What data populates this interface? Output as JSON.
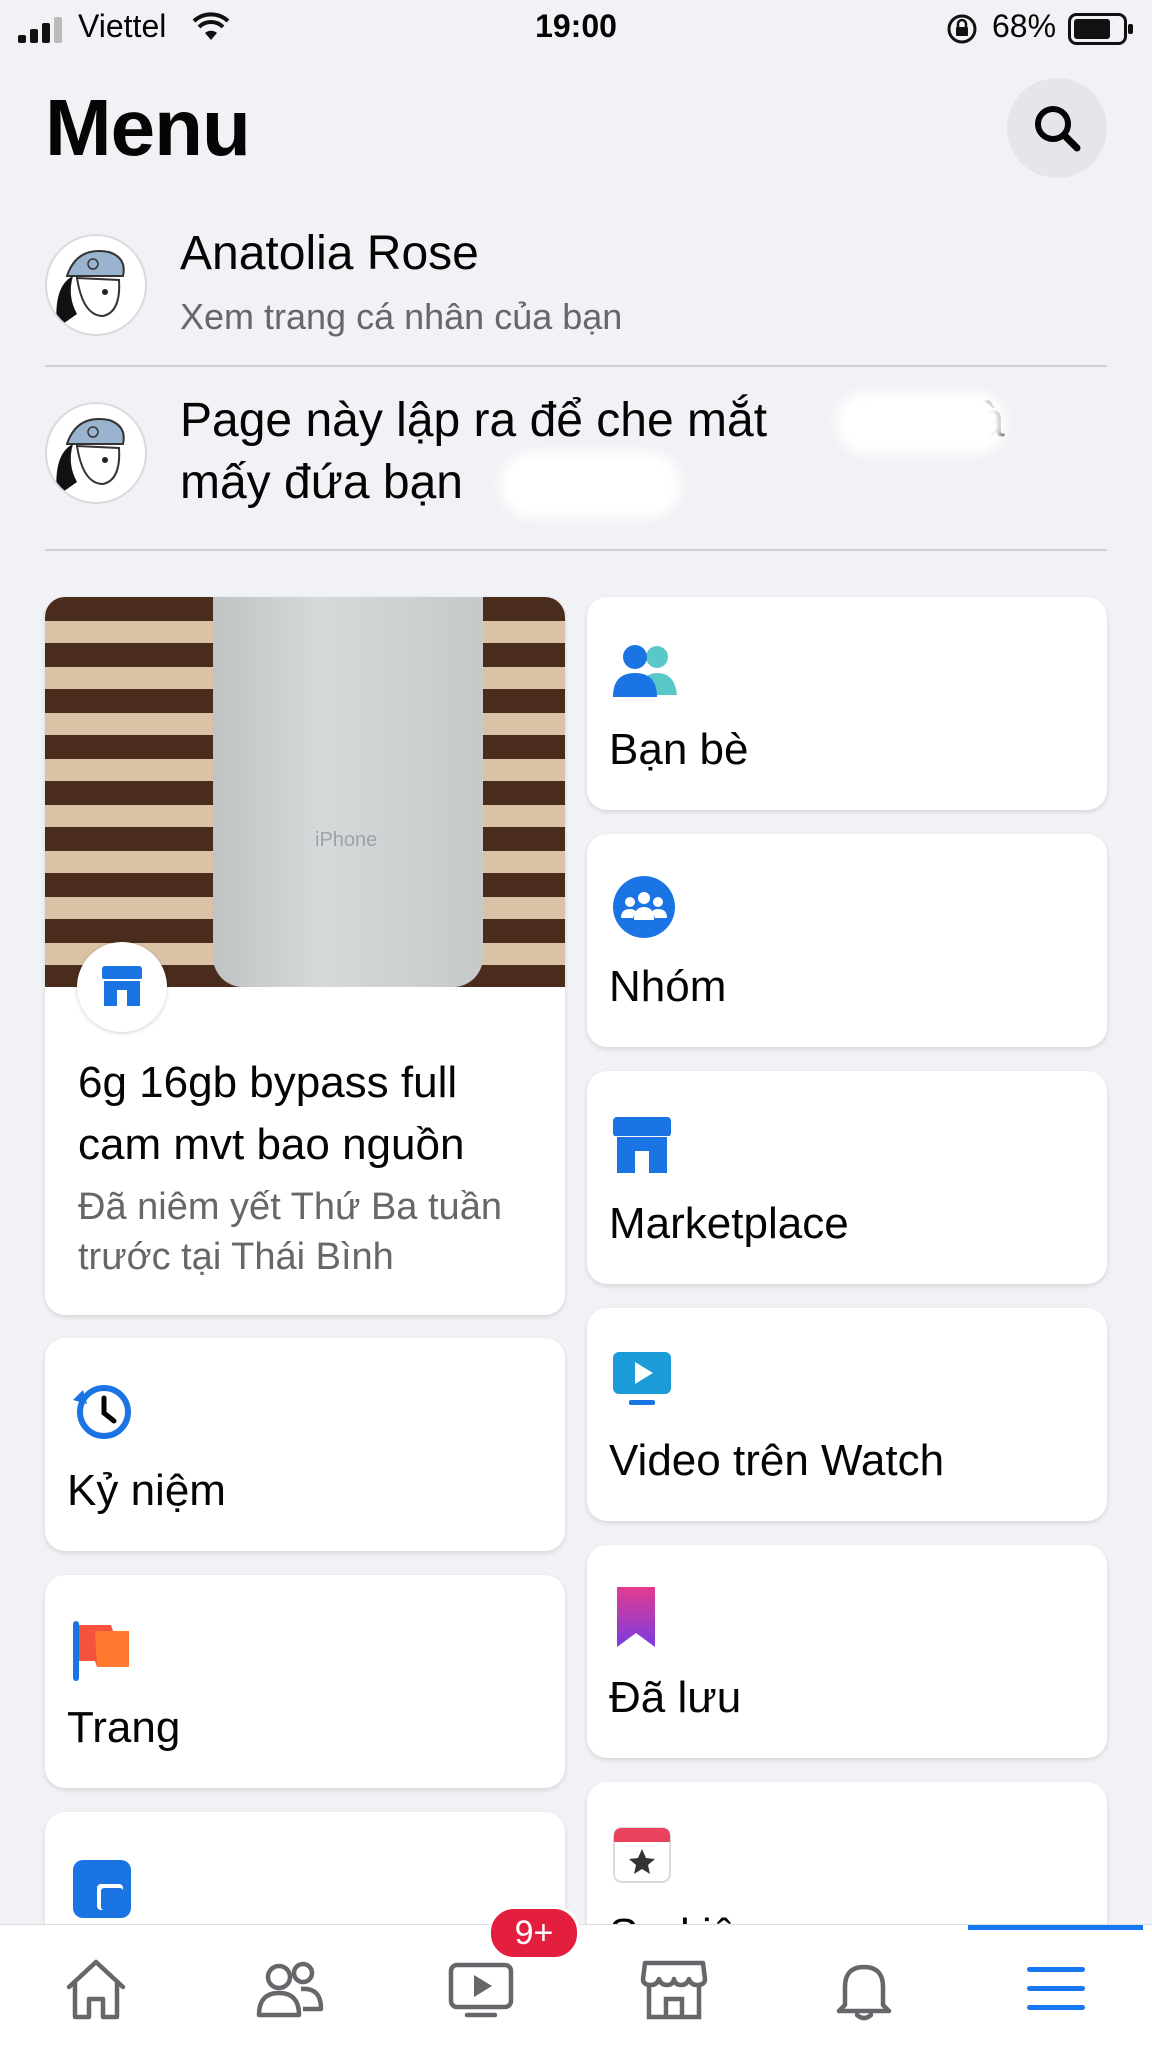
{
  "status_bar": {
    "carrier": "Viettel",
    "time": "19:00",
    "battery": "68%"
  },
  "header": {
    "title": "Menu"
  },
  "profile": {
    "name": "Anatolia Rose",
    "subtitle": "Xem trang cá nhân của bạn"
  },
  "page": {
    "line1": "Page này lập ra để che mắt",
    "line1_end": "và",
    "line2": "mấy đứa bạn"
  },
  "marketplace_card": {
    "image_text": "iPhone",
    "title": "6g 16gb bypass full cam mvt bao nguồn",
    "subtitle": "Đã niêm yết Thứ Ba tuần trước tại Thái Bình"
  },
  "shortcuts": {
    "friends": "Bạn bè",
    "groups": "Nhóm",
    "marketplace": "Marketplace",
    "watch": "Video trên Watch",
    "memories": "Kỷ niệm",
    "saved": "Đã lưu",
    "pages": "Trang",
    "events": "Sự kiện"
  },
  "bottom_nav": {
    "watch_badge": "9+",
    "active": "menu"
  },
  "colors": {
    "accent": "#1877f2",
    "badge": "#e41e3f",
    "background": "#f0f2f5"
  }
}
